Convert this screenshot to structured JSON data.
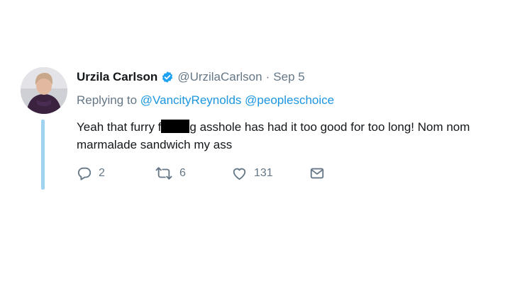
{
  "tweet": {
    "author": {
      "display_name": "Urzila Carlson",
      "handle": "@UrzilaCarlson",
      "verified": true
    },
    "separator": "·",
    "date": "Sep 5",
    "replying_to": {
      "prefix": "Replying to",
      "mentions": [
        "@VancityReynolds",
        "@peopleschoice"
      ]
    },
    "body": {
      "part1": "Yeah that furry f",
      "part2": "g asshole has had it too good for too long! Nom nom",
      "line2": "marmalade sandwich my ass"
    },
    "actions": {
      "replies": "2",
      "retweets": "6",
      "likes": "131"
    },
    "colors": {
      "accent": "#1b95e0",
      "muted": "#657786",
      "thread_line": "#9fd3f1",
      "text": "#14171a"
    }
  }
}
